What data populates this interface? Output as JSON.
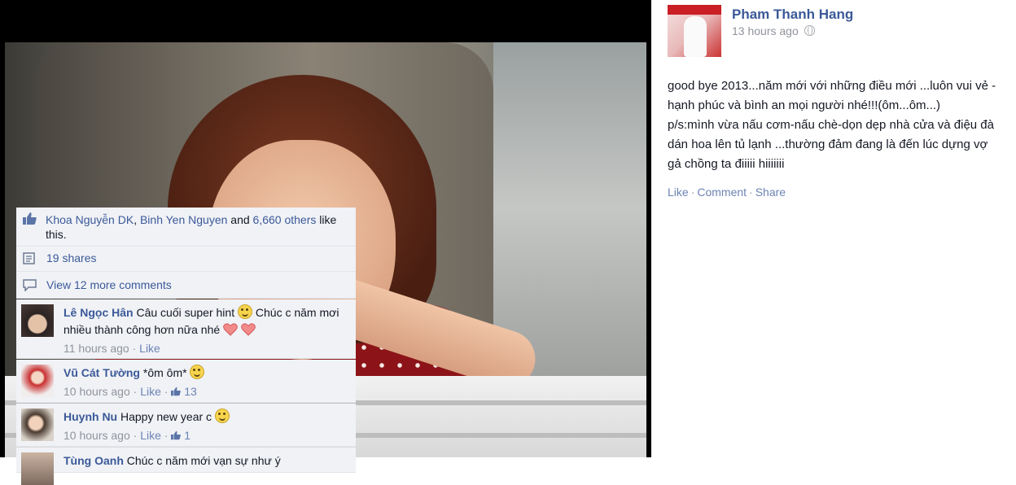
{
  "post": {
    "author": "Pham Thanh Hang",
    "timestamp": "13 hours ago",
    "body": "good bye 2013...năm mới với những điều mới ...luôn vui vẻ -hạnh phúc và bình an mọi người nhé!!!(ôm...ôm...)\np/s:mình vừa nấu cơm-nấu chè-dọn dẹp nhà cửa và điệu đà dán hoa lên tủ lạnh ...thường đảm đang là đến lúc dựng vợ gả chồng ta điiiii hiiiiiii",
    "actions": {
      "like": "Like",
      "comment": "Comment",
      "share": "Share",
      "separator": "·"
    }
  },
  "likes": {
    "person1": "Khoa Nguyễn DK",
    "comma": ", ",
    "person2": "Binh Yen Nguyen",
    "and": " and ",
    "others": "6,660 others",
    "suffix": " like this."
  },
  "shares": "19 shares",
  "more_comments": "View 12 more comments",
  "comments": [
    {
      "name": "Lê Ngọc Hân",
      "text_part1": "Câu cuối super hint",
      "text_part2": "Chúc c năm mơi nhiều thành công hơn nữa nhé",
      "time": "11 hours ago",
      "like": "Like",
      "likes": ""
    },
    {
      "name": "Vũ Cát Tường",
      "text_part1": "*ôm ôm*",
      "time": "10 hours ago",
      "like": "Like",
      "likes": "13"
    },
    {
      "name": "Huynh Nu",
      "text_part1": "Happy new year c",
      "time": "10 hours ago",
      "like": "Like",
      "likes": "1"
    },
    {
      "name": "Tùng Oanh",
      "text_part1": "Chúc c năm mới vạn sự như ý",
      "time": "",
      "like": "",
      "likes": ""
    }
  ],
  "icons": {
    "globe": "globe-icon",
    "like": "thumbs-up-icon",
    "share": "share-icon",
    "comment": "comment-bubble-icon",
    "smile": "smiley-emoji-icon",
    "heart": "heart-emoji-icon"
  },
  "colors": {
    "link": "#3b5998",
    "muted": "#90949c",
    "ufi_bg": "#f0f2f6"
  }
}
